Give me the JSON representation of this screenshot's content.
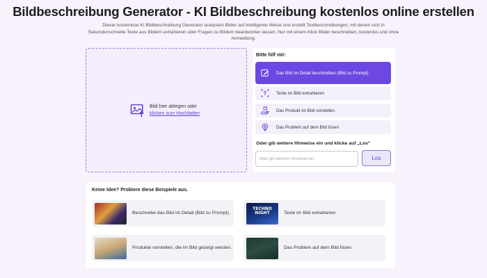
{
  "header": {
    "title": "Bildbeschreibung Generator - KI Bildbeschreibung kostenlos online erstellen",
    "description": "Dieser kostenlose KI Bildbeschreibung Generator analysiert Bilder auf intelligente Weise und erstellt Textbeschreibungen, mit denen sich in Sekundenschnelle Texte aus Bildern extrahieren oder Fragen zu Bildern beantworten lassen. Nur mit einem Klick Bilder beschreiben, kostenlos und ohne Anmeldung."
  },
  "upload": {
    "text": "Bild hier ablegen oder",
    "link": "klicken zum Hochladen",
    "icon": "image-upload-icon"
  },
  "options_panel": {
    "label": "Bitte hilf mir:",
    "options": [
      {
        "label": "Das Bild im Detail beschreiben (Bild zu Prompt)",
        "icon": "edit-image-icon",
        "active": true
      },
      {
        "label": "Texte im Bild extrahieren",
        "icon": "text-scan-icon",
        "active": false
      },
      {
        "label": "Das Produkt im Bild vorstellen",
        "icon": "product-hand-icon",
        "active": false
      },
      {
        "label": "Das Problem auf dem Bild lösen",
        "icon": "lightbulb-icon",
        "active": false
      }
    ],
    "hint_label": "Oder gib weitere Hinweise ein und klicke auf „Los“",
    "hint_placeholder": "Bitte gib weitere Hinweise ein",
    "go_label": "Los"
  },
  "examples": {
    "label": "Keine Idee? Probiere diese Beispiele aus.",
    "items": [
      {
        "text": "Beschreibe das Bild im Detail (Bild zu Prompt).",
        "thumb_text": ""
      },
      {
        "text": "Texte im Bild extrahieren.",
        "thumb_text": "TECHNO NIGHT"
      },
      {
        "text": "Produkte vorstellen, die im Bild gezeigt werden.",
        "thumb_text": ""
      },
      {
        "text": "Das Problem auf dem Bild lösen.",
        "thumb_text": ""
      }
    ]
  },
  "colors": {
    "accent": "#6c47e3",
    "background": "#f7f2fb",
    "link": "#5b3fd1"
  }
}
